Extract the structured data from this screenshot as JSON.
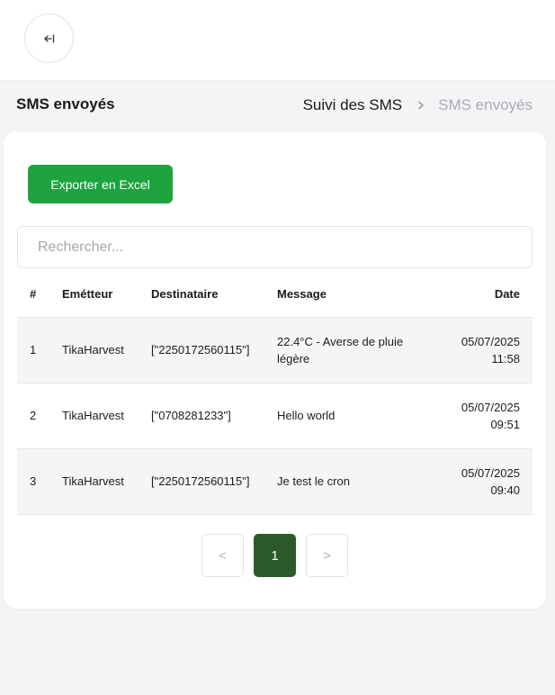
{
  "header": {
    "back_icon": "arrow-left-to-bar-icon"
  },
  "page": {
    "title": "SMS envoyés"
  },
  "breadcrumb": {
    "parent": "Suivi des SMS",
    "current": "SMS envoyés"
  },
  "toolbar": {
    "export_label": "Exporter en Excel",
    "export_color": "#1ea33f"
  },
  "search": {
    "placeholder": "Rechercher...",
    "value": ""
  },
  "table": {
    "columns": [
      "#",
      "Emétteur",
      "Destinataire",
      "Message",
      "Date"
    ],
    "rows": [
      {
        "num": "1",
        "sender": "TikaHarvest",
        "recipient": "[\"2250172560115\"]",
        "message": "22.4°C - Averse de pluie légère",
        "date": "05/07/2025",
        "time": "11:58"
      },
      {
        "num": "2",
        "sender": "TikaHarvest",
        "recipient": "[\"0708281233\"]",
        "message": "Hello world",
        "date": "05/07/2025",
        "time": "09:51"
      },
      {
        "num": "3",
        "sender": "TikaHarvest",
        "recipient": "[\"2250172560115\"]",
        "message": "Je test le cron",
        "date": "05/07/2025",
        "time": "09:40"
      }
    ]
  },
  "pagination": {
    "prev": "<",
    "current": "1",
    "next": ">",
    "active_color": "#2d5a2a"
  }
}
